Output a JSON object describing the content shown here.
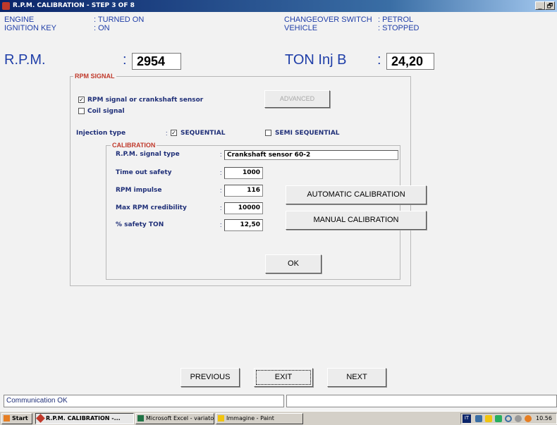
{
  "window": {
    "title": "R.P.M. CALIBRATION - STEP 3 OF 8",
    "min": "_",
    "max": "🗗",
    "close": "×"
  },
  "status": {
    "engine_label": "ENGINE",
    "engine_value": ": TURNED ON",
    "ignition_label": "IGNITION KEY",
    "ignition_value": ": ON",
    "switch_label": "CHANGEOVER SWITCH",
    "switch_value": ": PETROL",
    "vehicle_label": "VEHICLE",
    "vehicle_value": ": STOPPED"
  },
  "readouts": {
    "rpm_label": "R.P.M.",
    "rpm_colon": ":",
    "rpm_value": "2954",
    "ton_label": "TON Inj B",
    "ton_colon": ":",
    "ton_value": "24,20"
  },
  "rpm_signal": {
    "title": "RPM SIGNAL",
    "crank_label": "RPM signal or crankshaft sensor",
    "crank_checked": "✓",
    "coil_label": "Coil signal",
    "advanced_button": "ADVANCED",
    "injection_label": "Injection type",
    "sequential_label": "SEQUENTIAL",
    "sequential_checked": "✓",
    "sequential_prefix": ":",
    "semi_label": "SEMI SEQUENTIAL"
  },
  "calibration": {
    "title": "CALIBRATION",
    "signal_type_label": "R.P.M. signal type",
    "signal_type_value": "Crankshaft sensor 60-2",
    "timeout_label": "Time out safety",
    "timeout_value": "1000",
    "impulse_label": "RPM impulse",
    "impulse_value": "116",
    "max_rpm_label": "Max RPM credibility",
    "max_rpm_value": "10000",
    "safety_ton_label": "% safety TON",
    "safety_ton_value": "12,50",
    "auto_button": "AUTOMATIC CALIBRATION",
    "manual_button": "MANUAL CALIBRATION",
    "ok_button": "OK"
  },
  "nav": {
    "previous": "PREVIOUS",
    "exit": "EXIT",
    "next": "NEXT"
  },
  "statusbar": {
    "message": "Communication OK",
    "second": ""
  },
  "taskbar": {
    "start": "Start",
    "tasks": [
      "R.P.M. CALIBRATION -...",
      "Microsoft Excel - variator...",
      "Immagine - Paint"
    ],
    "lang": "IT",
    "clock": "10.56"
  },
  "colors": {
    "title_bar": "#0a246a",
    "label_blue": "#1f3ea8",
    "group_title_red": "#c0392b"
  }
}
